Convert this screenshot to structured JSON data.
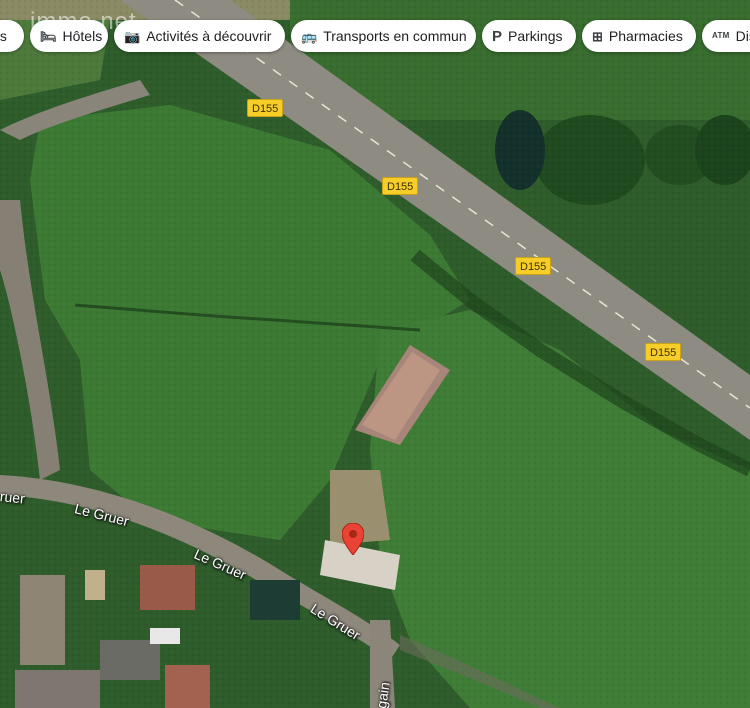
{
  "watermark": "immo.net",
  "chips": [
    {
      "label": "ts",
      "icon": "partial-chip"
    },
    {
      "label": "Hôtels",
      "icon": "bed-icon"
    },
    {
      "label": "Activités à découvrir",
      "icon": "camera-icon"
    },
    {
      "label": "Transports en commun",
      "icon": "bus-icon"
    },
    {
      "label": "Parkings",
      "icon": "parking-icon"
    },
    {
      "label": "Pharmacies",
      "icon": "pharmacy-icon"
    },
    {
      "label": "Dis",
      "icon": "atm-icon",
      "icon_text": "ATM"
    }
  ],
  "road_shields": [
    "D155",
    "D155",
    "D155",
    "D155"
  ],
  "street_labels": [
    "Le Gruer",
    "Le Gruer",
    "Le Gruer",
    "ruer",
    "egain"
  ],
  "marker": {
    "color": "#ea4335"
  },
  "colors": {
    "road_shield": "#f7cd28",
    "grass_dark": "#2c5a28",
    "grass_light": "#3f7a34",
    "road": "#8f8a7f"
  }
}
